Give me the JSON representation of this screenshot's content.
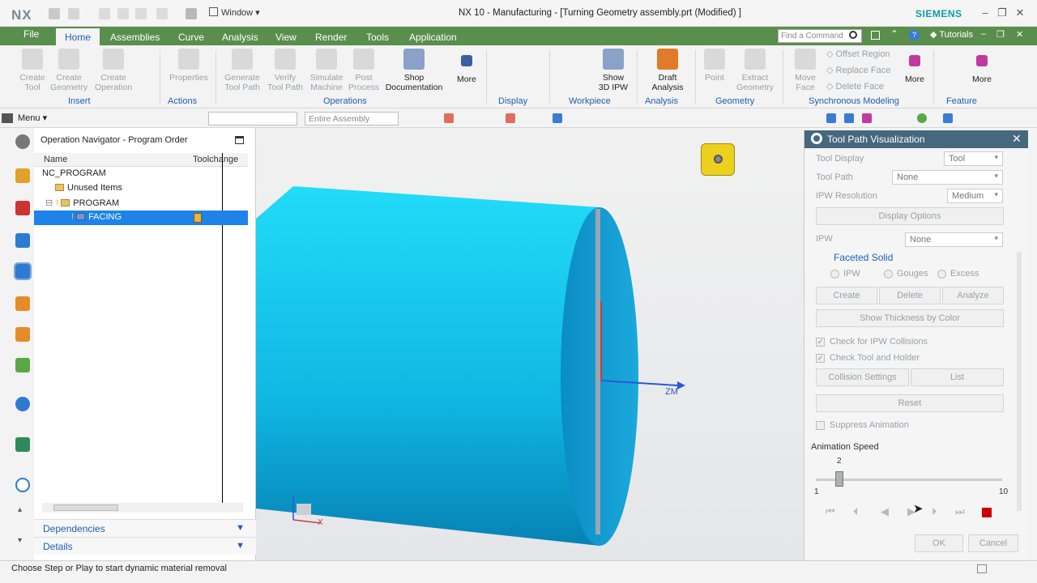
{
  "app": {
    "logo": "NX",
    "window_menu": "Window",
    "title": "NX 10 - Manufacturing - [Turning Geometry assembly.prt (Modified) ]",
    "brand": "SIEMENS"
  },
  "tabs": {
    "file": "File",
    "items": [
      "Home",
      "Assemblies",
      "Curve",
      "Analysis",
      "View",
      "Render",
      "Tools",
      "Application"
    ]
  },
  "search": {
    "placeholder": "Find a Command"
  },
  "help": {
    "tutorials": "Tutorials"
  },
  "ribbon": {
    "create_tool": "Create\nTool",
    "create_geometry": "Create\nGeometry",
    "create_operation": "Create\nOperation",
    "properties": "Properties",
    "generate_tool_path": "Generate\nTool Path",
    "verify_tool_path": "Verify\nTool Path",
    "simulate_machine": "Simulate\nMachine",
    "post_process": "Post\nProcess",
    "shop_documentation": "Shop\nDocumentation",
    "more": "More",
    "show_3d_ipw": "Show\n3D IPW",
    "draft_analysis": "Draft\nAnalysis",
    "point": "Point",
    "extract_geometry": "Extract\nGeometry",
    "move_face": "Move\nFace",
    "offset_region": "Offset Region",
    "replace_face": "Replace Face",
    "delete_face": "Delete Face",
    "more2": "More",
    "more3": "More",
    "groups": {
      "insert": "Insert",
      "actions": "Actions",
      "operations": "Operations",
      "display": "Display",
      "workpiece": "Workpiece",
      "analysis": "Analysis",
      "geometry": "Geometry",
      "synchronous_modeling": "Synchronous Modeling",
      "feature": "Feature"
    }
  },
  "toolbar2": {
    "menu": "Menu",
    "filter_value": "",
    "scope": "Entire Assembly"
  },
  "navigator": {
    "title": "Operation Navigator - Program Order",
    "col_name": "Name",
    "col_toolchange": "Toolchange",
    "rows": [
      "NC_PROGRAM",
      "Unused Items",
      "PROGRAM",
      "FACING"
    ],
    "dependencies": "Dependencies",
    "details": "Details"
  },
  "viewport": {
    "axis_z": "ZM",
    "axis_x": "X"
  },
  "tpv": {
    "title": "Tool Path Visualization",
    "tool_display_label": "Tool Display",
    "tool_display_value": "Tool",
    "tool_path_label": "Tool Path",
    "tool_path_value": "None",
    "ipw_res_label": "IPW Resolution",
    "ipw_res_value": "Medium",
    "display_options": "Display Options",
    "ipw_label": "IPW",
    "ipw_value": "None",
    "faceted_solid": "Faceted Solid",
    "radio_ipw": "IPW",
    "radio_gouges": "Gouges",
    "radio_excess": "Excess",
    "btn_create": "Create",
    "btn_delete": "Delete",
    "btn_analyze": "Analyze",
    "show_thickness": "Show Thickness by Color",
    "check_ipw": "Check for IPW Collisions",
    "check_tool": "Check Tool and Holder",
    "collision_settings": "Collision Settings",
    "list": "List",
    "reset": "Reset",
    "suppress": "Suppress Animation",
    "anim_speed": "Animation Speed",
    "speed_value": "2",
    "speed_min": "1",
    "speed_max": "10",
    "ok": "OK",
    "cancel": "Cancel"
  },
  "status": {
    "message": "Choose Step or Play to start dynamic material removal"
  },
  "colors": {
    "tab_green": "#5a8e4c",
    "accent_blue": "#1f5fae",
    "selection": "#1d83e8",
    "panel_header": "#46687e",
    "part_cyan": "#19c4ee"
  }
}
